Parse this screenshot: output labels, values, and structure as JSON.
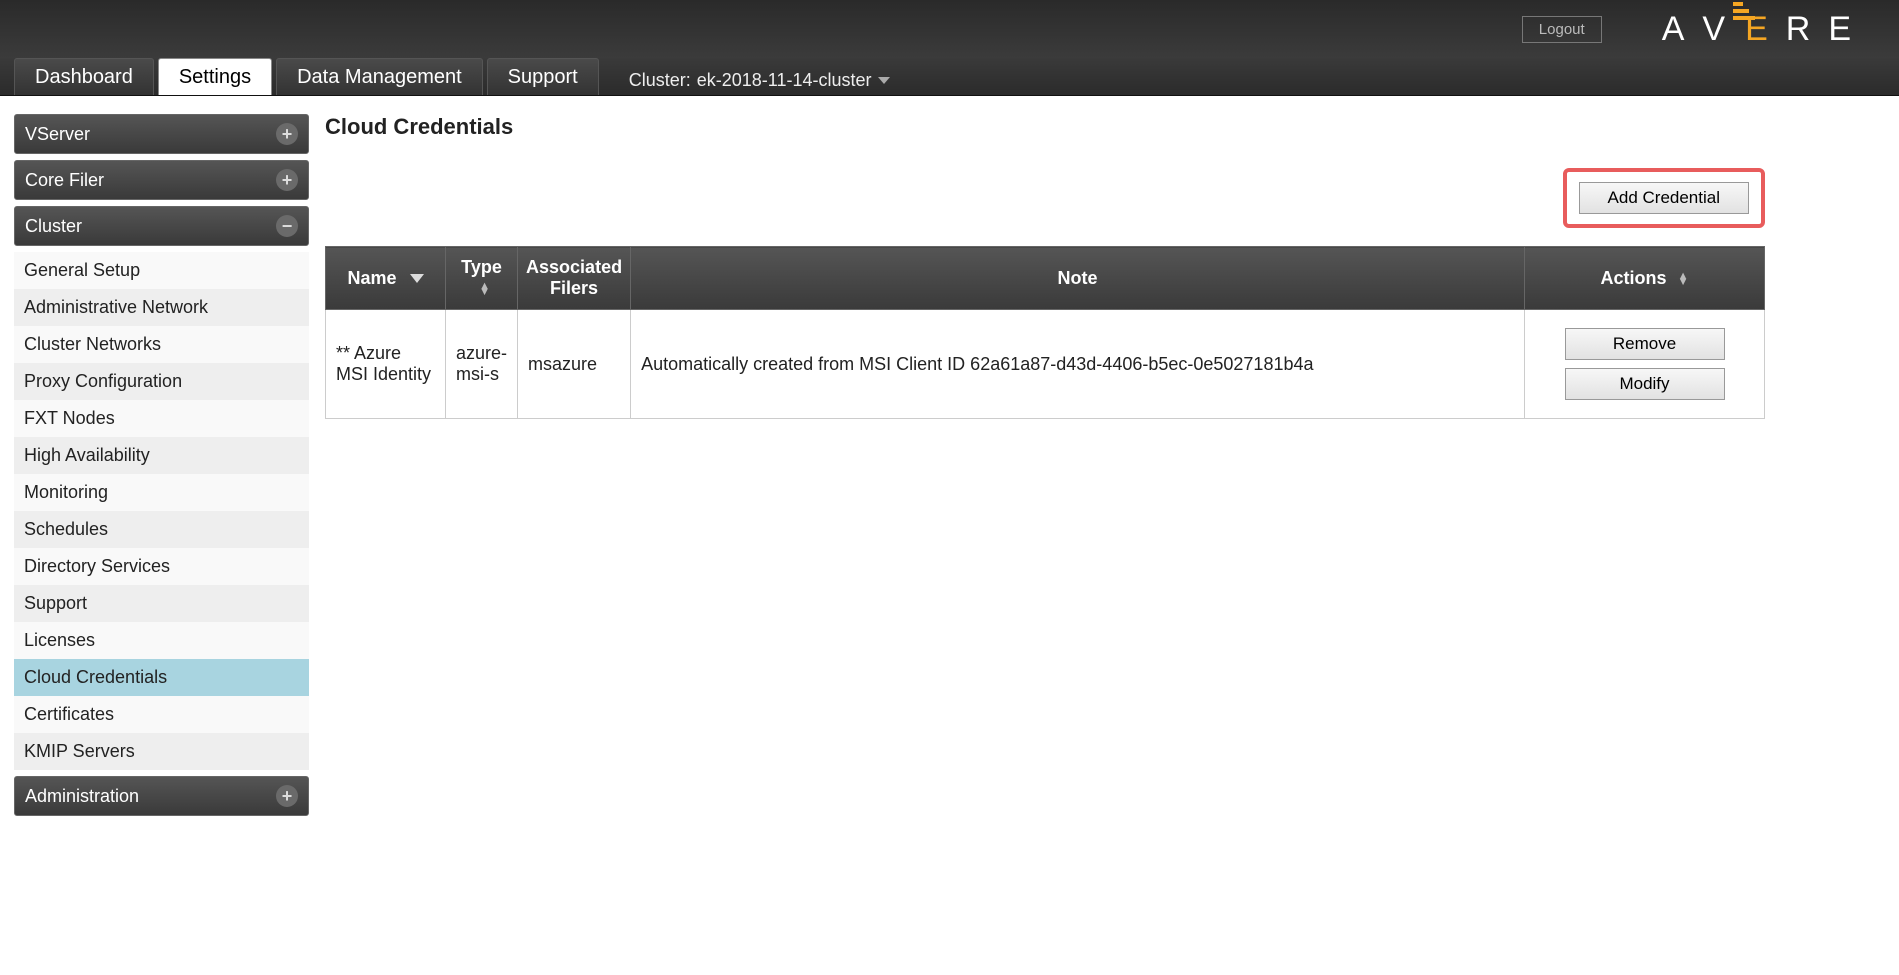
{
  "header": {
    "logout": "Logout",
    "logo_letters": [
      "A",
      "V",
      "E",
      "R",
      "E"
    ]
  },
  "nav": {
    "tabs": [
      {
        "label": "Dashboard",
        "active": false
      },
      {
        "label": "Settings",
        "active": true
      },
      {
        "label": "Data Management",
        "active": false
      },
      {
        "label": "Support",
        "active": false
      }
    ],
    "cluster_prefix": "Cluster: ",
    "cluster_name": "ek-2018-11-14-cluster"
  },
  "sidebar": {
    "sections": [
      {
        "title": "VServer",
        "icon": "plus",
        "expanded": false,
        "items": []
      },
      {
        "title": "Core Filer",
        "icon": "plus",
        "expanded": false,
        "items": []
      },
      {
        "title": "Cluster",
        "icon": "minus",
        "expanded": true,
        "items": [
          {
            "label": "General Setup",
            "selected": false
          },
          {
            "label": "Administrative Network",
            "selected": false
          },
          {
            "label": "Cluster Networks",
            "selected": false
          },
          {
            "label": "Proxy Configuration",
            "selected": false
          },
          {
            "label": "FXT Nodes",
            "selected": false
          },
          {
            "label": "High Availability",
            "selected": false
          },
          {
            "label": "Monitoring",
            "selected": false
          },
          {
            "label": "Schedules",
            "selected": false
          },
          {
            "label": "Directory Services",
            "selected": false
          },
          {
            "label": "Support",
            "selected": false
          },
          {
            "label": "Licenses",
            "selected": false
          },
          {
            "label": "Cloud Credentials",
            "selected": true
          },
          {
            "label": "Certificates",
            "selected": false
          },
          {
            "label": "KMIP Servers",
            "selected": false
          }
        ]
      },
      {
        "title": "Administration",
        "icon": "plus",
        "expanded": false,
        "items": []
      }
    ]
  },
  "page": {
    "title": "Cloud Credentials",
    "add_button": "Add Credential",
    "columns": [
      "Name",
      "Type",
      "Associated Filers",
      "Note",
      "Actions"
    ],
    "rows": [
      {
        "name": "** Azure MSI Identity",
        "type": "azure-msi-s",
        "filers": "msazure",
        "note": "Automatically created from MSI Client ID 62a61a87-d43d-4406-b5ec-0e5027181b4a",
        "remove": "Remove",
        "modify": "Modify"
      }
    ]
  }
}
